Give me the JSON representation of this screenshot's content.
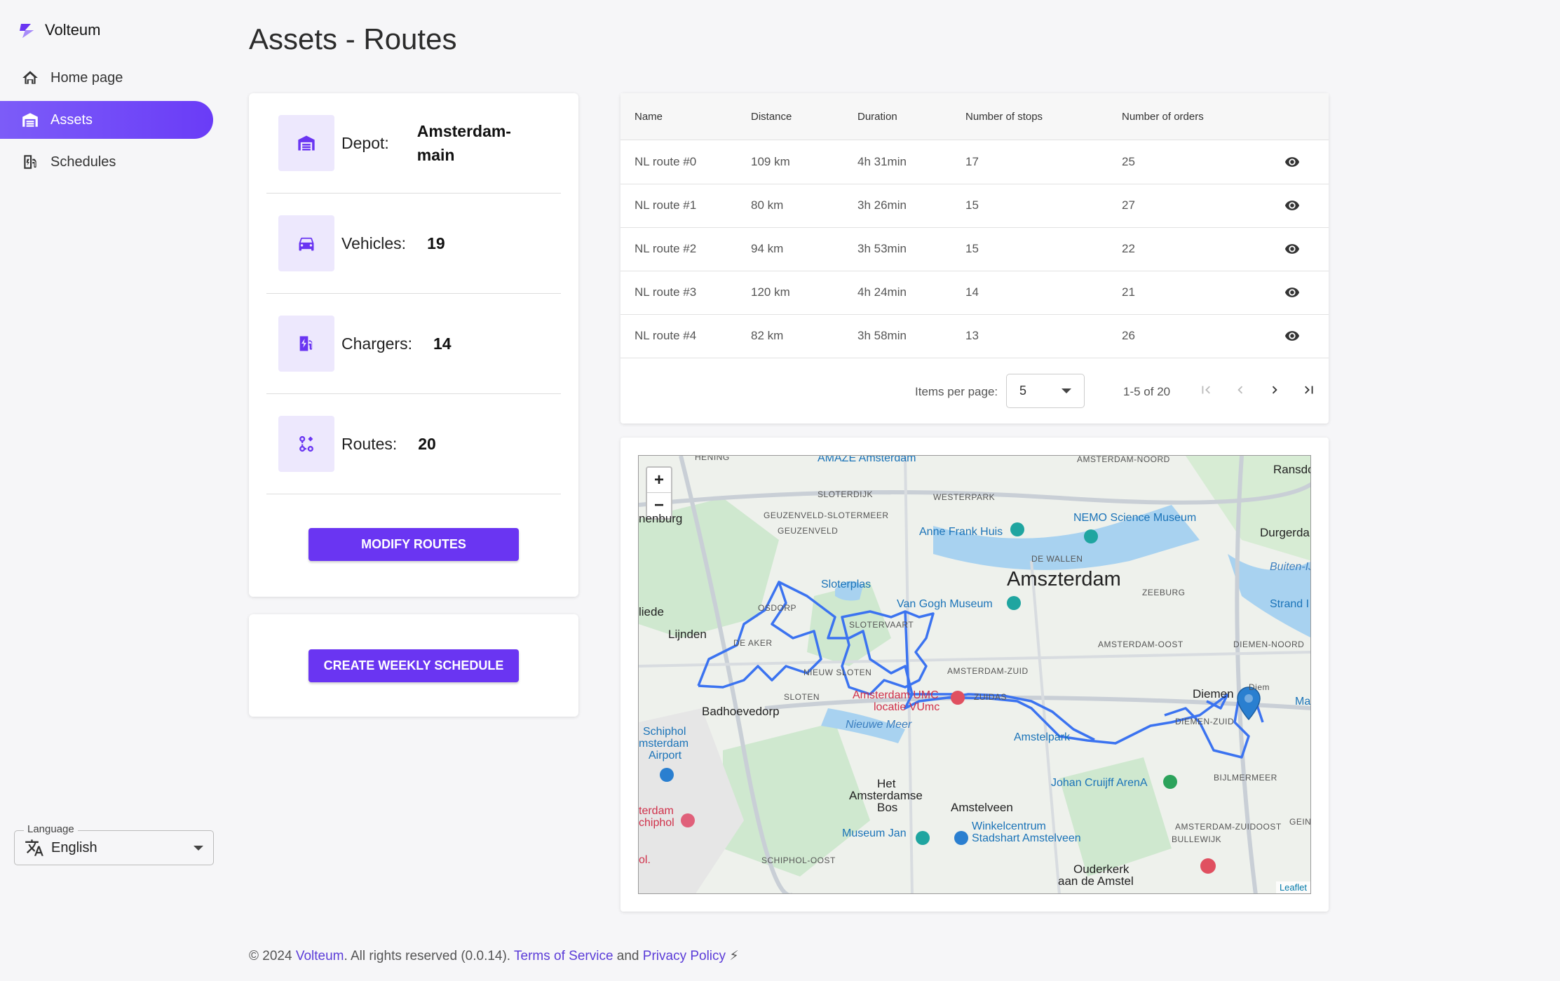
{
  "app": {
    "name": "Volteum"
  },
  "sidebar": {
    "items": [
      {
        "label": "Home page",
        "icon": "home-icon"
      },
      {
        "label": "Assets",
        "icon": "warehouse-icon",
        "active": true
      },
      {
        "label": "Schedules",
        "icon": "charger-doc-icon"
      }
    ],
    "language": {
      "label": "Language",
      "value": "English"
    }
  },
  "page": {
    "title": "Assets - Routes"
  },
  "stats": {
    "depot": {
      "label": "Depot:",
      "value": "Amsterdam-main"
    },
    "vehicles": {
      "label": "Vehicles:",
      "value": "19"
    },
    "chargers": {
      "label": "Chargers:",
      "value": "14"
    },
    "routes": {
      "label": "Routes:",
      "value": "20"
    },
    "modify_button": "Modify routes",
    "schedule_button": "Create weekly schedule"
  },
  "table": {
    "headers": {
      "name": "Name",
      "distance": "Distance",
      "duration": "Duration",
      "stops": "Number of stops",
      "orders": "Number of orders"
    },
    "rows": [
      {
        "name": "NL route #0",
        "distance": "109 km",
        "duration": "4h 31min",
        "stops": "17",
        "orders": "25"
      },
      {
        "name": "NL route #1",
        "distance": "80 km",
        "duration": "3h 26min",
        "stops": "15",
        "orders": "27"
      },
      {
        "name": "NL route #2",
        "distance": "94 km",
        "duration": "3h 53min",
        "stops": "15",
        "orders": "22"
      },
      {
        "name": "NL route #3",
        "distance": "120 km",
        "duration": "4h 24min",
        "stops": "14",
        "orders": "21"
      },
      {
        "name": "NL route #4",
        "distance": "82 km",
        "duration": "3h 58min",
        "stops": "13",
        "orders": "26"
      }
    ],
    "paginator": {
      "items_per_page_label": "Items per page:",
      "items_per_page": "5",
      "range": "1-5 of 20"
    }
  },
  "map": {
    "zoom_in": "+",
    "zoom_out": "−",
    "attribution": "Leaflet",
    "labels": {
      "amsterdam": "Amszterdam",
      "amsterdam_noord": "AMSTERDAM-NOORD",
      "ransdorp": "Ransdo",
      "slotedijk": "SLOTERDIJK",
      "westerpark": "WESTERPARK",
      "geuzenveld_slotermeer": "GEUZENVELD-SLOTERMEER",
      "geuzenveld": "GEUZENVELD",
      "nemo": "NEMO Science Museum",
      "durgerdam": "Durgerda",
      "anne_frank": "Anne Frank Huis",
      "de_wallen": "DE WALLEN",
      "buiten_ij": "Buiten-IJ",
      "sloterplas": "Sloterplas",
      "van_gogh": "Van Gogh Museum",
      "zeeburg": "ZEEBURG",
      "strand": "Strand I",
      "liede": "liede",
      "lijnden": "Lijnden",
      "osdorp": "OSDORP",
      "slotervaart": "SLOTERVAART",
      "de_aker": "DE AKER",
      "amsterdam_oost": "AMSTERDAM-OOST",
      "diemen_noord": "DIEMEN-NOORD",
      "amsterdam_zuid": "AMSTERDAM-ZUID",
      "nieuw_sloten": "NIEUW SLOTEN",
      "zuidas": "ZUIDAS",
      "diemen": "Diemen",
      "diemen_zuid": "DIEMEN-ZUID",
      "sloten": "SLOTEN",
      "amsterdam_umc": "Amsterdam UMC",
      "locatie_vumc": "locatie VUmc",
      "badhoevedorp": "Badhoevedorp",
      "nieuwe_meer": "Nieuwe Meer",
      "schiphol": "Schiphol",
      "amsterdam_airport": "msterdam",
      "airport": "Airport",
      "amstelpark": "Amstelpark",
      "bijlmermeer": "BIJLMERMEER",
      "johan_cruijff": "Johan Cruijff ArenA",
      "het_bos_1": "Het",
      "het_bos_2": "Amsterdamse",
      "het_bos_3": "Bos",
      "amstelveen": "Amstelveen",
      "amsterdam_zuidoost": "AMSTERDAM-ZUIDOOST",
      "bullewijk": "BULLEWIJK",
      "schiphol_hotel_1": "terdam",
      "schiphol_hotel_2": "chiphol",
      "winkelcentrum_1": "Winkelcentrum",
      "winkelcentrum_2": "Stadshart Amstelveen",
      "museum_jan": "Museum Jan",
      "schiphol_oost": "SCHIPHOL-OOST",
      "ouderkerk_1": "Ouderkerk",
      "ouderkerk_2": "aan de Amstel",
      "gein": "GEIN",
      "maxis": "Maxi",
      "diem": "Diem",
      "nenburg": "nenburg",
      "amazewith": "AMAZE Amsterdam",
      "ol": "ol.",
      "hening": "HENING"
    }
  },
  "footer": {
    "prefix": "© 2024",
    "brand": "Volteum",
    "rights": ". All rights reserved (0.0.14).",
    "terms": "Terms of Service",
    "and": "and",
    "privacy": "Privacy Policy"
  },
  "colors": {
    "accent": "#6a35f2",
    "accent_light": "#ede8fd",
    "route": "#3b73f0"
  }
}
